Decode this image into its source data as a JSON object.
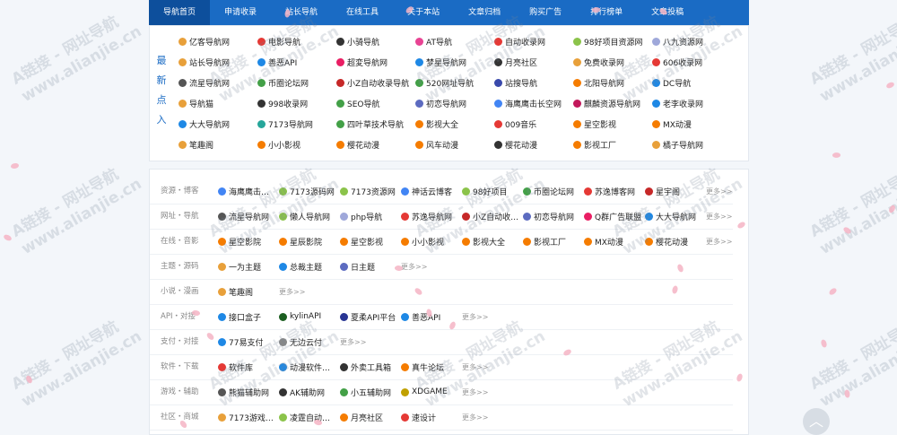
{
  "nav": {
    "items": [
      "导航首页",
      "申请收录",
      "站长导航",
      "在线工具",
      "关于本站",
      "文章归档",
      "购买广告",
      "排行榜单",
      "文章投稿"
    ],
    "active_index": 0,
    "bg_color": "#1a6bc4"
  },
  "recommend": {
    "label": "最新点入",
    "items": [
      {
        "t": "亿客导航网",
        "c": "#e8a03a"
      },
      {
        "t": "电影导航",
        "c": "#e53935"
      },
      {
        "t": "小骑导航",
        "c": "#333"
      },
      {
        "t": "AT导航",
        "c": "#e84393"
      },
      {
        "t": "自动收录网",
        "c": "#e53935"
      },
      {
        "t": "98好项目资源网",
        "c": "#8bc34a"
      },
      {
        "t": "八九资源网",
        "c": "#9fa8da"
      },
      {
        "t": "站长导航网",
        "c": "#e8a03a"
      },
      {
        "t": "善恶API",
        "c": "#1e88e5"
      },
      {
        "t": "超変导航网",
        "c": "#e91e63"
      },
      {
        "t": "梦星导航网",
        "c": "#1e88e5"
      },
      {
        "t": "月亮社区",
        "c": "#333"
      },
      {
        "t": "免费收录网",
        "c": "#e8a03a"
      },
      {
        "t": "606收录网",
        "c": "#e53935"
      },
      {
        "t": "流星导航网",
        "c": "#555"
      },
      {
        "t": "币圈论坛网",
        "c": "#43a047"
      },
      {
        "t": "小Z自动收录导航",
        "c": "#c62828"
      },
      {
        "t": "520网址导航",
        "c": "#43a047"
      },
      {
        "t": "站搜导航",
        "c": "#3949ab"
      },
      {
        "t": "北阳导航网",
        "c": "#f57c00"
      },
      {
        "t": "DC导航",
        "c": "#1e88e5"
      },
      {
        "t": "导航猫",
        "c": "#e8a03a"
      },
      {
        "t": "998收录网",
        "c": "#333"
      },
      {
        "t": "SEO导航",
        "c": "#43a047"
      },
      {
        "t": "初恋导航网",
        "c": "#5c6bc0"
      },
      {
        "t": "海鹰鹰击长空网",
        "c": "#4285f4"
      },
      {
        "t": "麒麟资源导航网",
        "c": "#c2185b"
      },
      {
        "t": "老李收录网",
        "c": "#1e88e5"
      },
      {
        "t": "大大导航网",
        "c": "#1e88e5"
      },
      {
        "t": "7173导航网",
        "c": "#26a69a"
      },
      {
        "t": "四叶草技术导航",
        "c": "#43a047"
      },
      {
        "t": "影视大全",
        "c": "#f57c00"
      },
      {
        "t": "009音乐",
        "c": "#e53935"
      },
      {
        "t": "星空影视",
        "c": "#f57c00"
      },
      {
        "t": "MX动漫",
        "c": "#f57c00"
      },
      {
        "t": "笔趣阁",
        "c": "#e8a03a"
      },
      {
        "t": "小小影视",
        "c": "#f57c00"
      },
      {
        "t": "樱花动漫",
        "c": "#f57c00"
      },
      {
        "t": "风车动漫",
        "c": "#f57c00"
      },
      {
        "t": "樱花动漫",
        "c": "#333"
      },
      {
        "t": "影视工厂",
        "c": "#f57c00"
      },
      {
        "t": "橘子导航网",
        "c": "#e8a03a"
      }
    ]
  },
  "categories": [
    {
      "label": "资源・博客",
      "links": [
        {
          "t": "海鹰鹰击…",
          "c": "#4285f4"
        },
        {
          "t": "7173源码网",
          "c": "#8bc34a"
        },
        {
          "t": "7173资源网",
          "c": "#8bc34a"
        },
        {
          "t": "神话云博客",
          "c": "#4285f4"
        },
        {
          "t": "98好项目",
          "c": "#8bc34a"
        },
        {
          "t": "币圈论坛网",
          "c": "#43a047"
        },
        {
          "t": "苏逸博客网",
          "c": "#e53935"
        },
        {
          "t": "星宇阁",
          "c": "#c62828"
        }
      ],
      "more": "更多>>"
    },
    {
      "label": "网址・导航",
      "links": [
        {
          "t": "流星导航网",
          "c": "#555"
        },
        {
          "t": "懒人导航网",
          "c": "#8bc34a"
        },
        {
          "t": "php导航",
          "c": "#9fa8da"
        },
        {
          "t": "苏逸导航网",
          "c": "#e53935"
        },
        {
          "t": "小Z自动收…",
          "c": "#c62828"
        },
        {
          "t": "初恋导航网",
          "c": "#5c6bc0"
        },
        {
          "t": "Q群广告联盟",
          "c": "#e91e63"
        },
        {
          "t": "大大导航网",
          "c": "#1e88e5"
        }
      ],
      "more": "更多>>"
    },
    {
      "label": "在线・音影",
      "links": [
        {
          "t": "星空影院",
          "c": "#f57c00"
        },
        {
          "t": "星辰影院",
          "c": "#f57c00"
        },
        {
          "t": "星空影视",
          "c": "#f57c00"
        },
        {
          "t": "小小影视",
          "c": "#f57c00"
        },
        {
          "t": "影视大全",
          "c": "#f57c00"
        },
        {
          "t": "影视工厂",
          "c": "#f57c00"
        },
        {
          "t": "MX动漫",
          "c": "#f57c00"
        },
        {
          "t": "樱花动漫",
          "c": "#f57c00"
        }
      ],
      "more": "更多>>"
    },
    {
      "label": "主题・源码",
      "links": [
        {
          "t": "一为主题",
          "c": "#e8a03a"
        },
        {
          "t": "总裁主题",
          "c": "#1e88e5"
        },
        {
          "t": "日主题",
          "c": "#5c6bc0"
        }
      ],
      "more": "更多>>"
    },
    {
      "label": "小说・漫画",
      "links": [
        {
          "t": "笔趣阁",
          "c": "#e8a03a"
        }
      ],
      "more": "更多>>"
    },
    {
      "label": "API・对接",
      "links": [
        {
          "t": "接口盒子",
          "c": "#1e88e5"
        },
        {
          "t": "kylinAPI",
          "c": "#1b5e20"
        },
        {
          "t": "夏柔API平台",
          "c": "#283593"
        },
        {
          "t": "善恶API",
          "c": "#1e88e5"
        }
      ],
      "more": "更多>>"
    },
    {
      "label": "支付・对接",
      "links": [
        {
          "t": "77易支付",
          "c": "#1e88e5"
        },
        {
          "t": "无边云付",
          "c": "#888"
        }
      ],
      "more": "更多>>"
    },
    {
      "label": "软件・下载",
      "links": [
        {
          "t": "软件库",
          "c": "#e53935"
        },
        {
          "t": "动漫软件…",
          "c": "#1e88e5"
        },
        {
          "t": "外卖工具箱",
          "c": "#333"
        },
        {
          "t": "真牛论坛",
          "c": "#f57c00"
        }
      ],
      "more": "更多>>"
    },
    {
      "label": "游戏・辅助",
      "links": [
        {
          "t": "熊猫辅助网",
          "c": "#555"
        },
        {
          "t": "AK辅助网",
          "c": "#333"
        },
        {
          "t": "小五辅助网",
          "c": "#43a047"
        },
        {
          "t": "XDGAME",
          "c": "#c0a000"
        }
      ],
      "more": "更多>>"
    },
    {
      "label": "社区・商城",
      "links": [
        {
          "t": "7173游戏…",
          "c": "#e8a03a"
        },
        {
          "t": "凌霆自动…",
          "c": "#8bc34a"
        },
        {
          "t": "月亮社区",
          "c": "#f57c00"
        },
        {
          "t": "速设计",
          "c": "#e53935"
        }
      ],
      "more": "更多>>"
    }
  ],
  "watermark": "A链接 - 网址导航\nwww.alianjie.cn",
  "back_to_top": "︿"
}
